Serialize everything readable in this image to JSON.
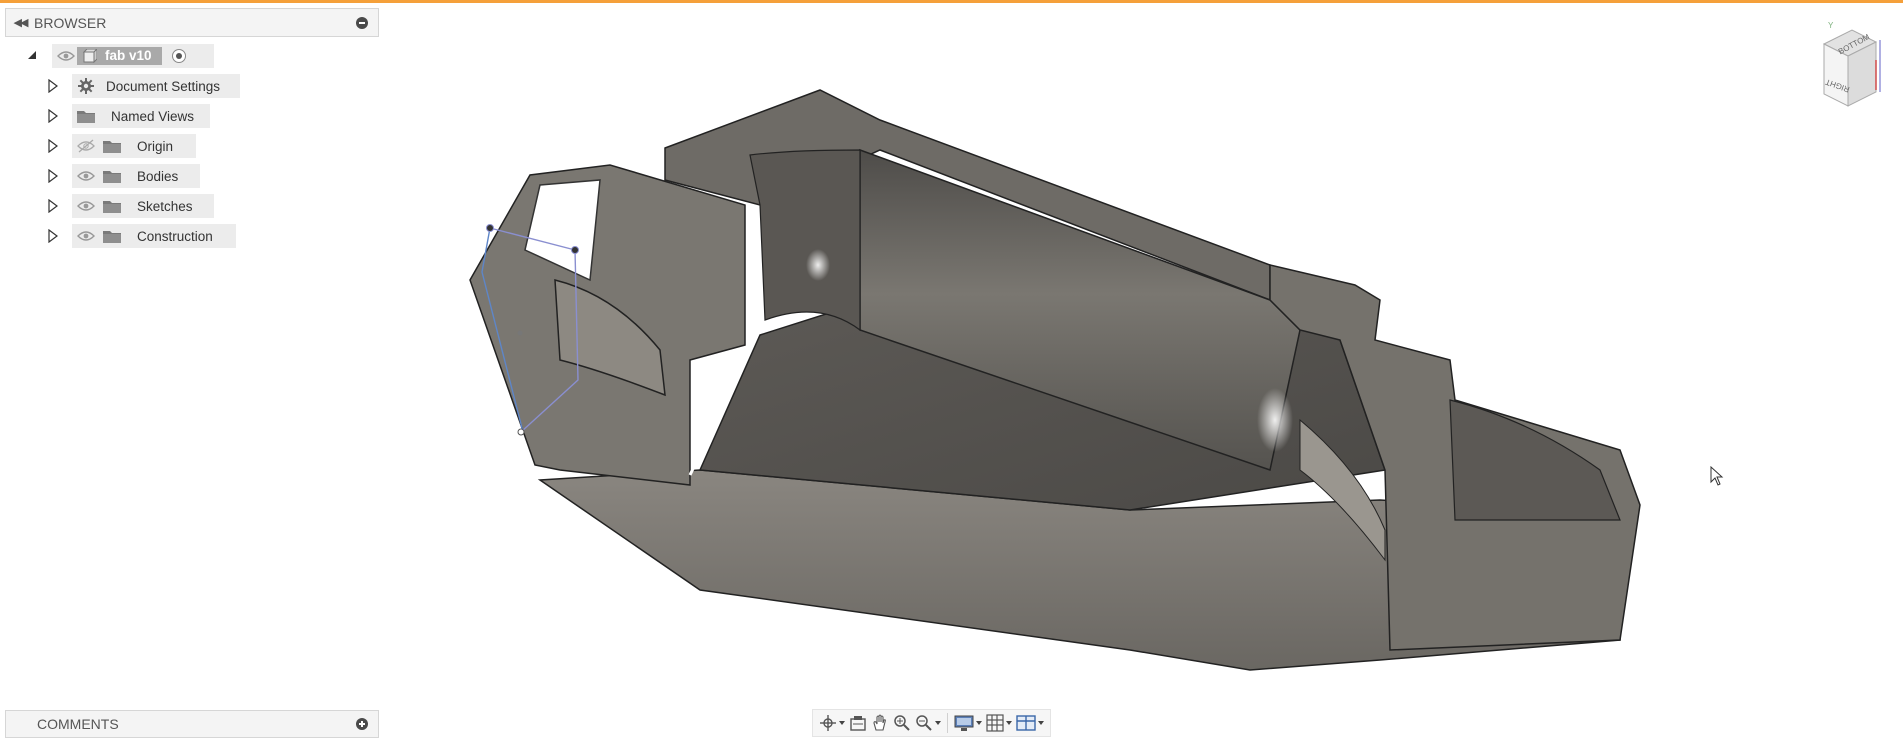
{
  "browser": {
    "title": "BROWSER",
    "root": {
      "name": "fab v10"
    },
    "items": [
      {
        "label": "Document Settings",
        "icon": "gear-icon"
      },
      {
        "label": "Named Views",
        "icon": "folder-icon"
      },
      {
        "label": "Origin",
        "icon": "folder-icon",
        "visibility": "hidden"
      },
      {
        "label": "Bodies",
        "icon": "folder-icon",
        "visibility": "visible"
      },
      {
        "label": "Sketches",
        "icon": "folder-icon",
        "visibility": "visible"
      },
      {
        "label": "Construction",
        "icon": "folder-icon",
        "visibility": "visible"
      }
    ]
  },
  "comments": {
    "title": "COMMENTS"
  },
  "viewcube": {
    "top_face": "BOTTOM",
    "side_face": "RIGHT"
  },
  "toolbar": {
    "tools": [
      "orbit-icon",
      "look-at-icon",
      "pan-icon",
      "zoom-icon",
      "fit-icon",
      "display-settings-icon",
      "grid-icon",
      "viewports-icon"
    ]
  },
  "colors": {
    "accent": "#f5a03a",
    "panel": "#f4f4f4",
    "chip": "#ececec",
    "model": "#6e6a64"
  }
}
